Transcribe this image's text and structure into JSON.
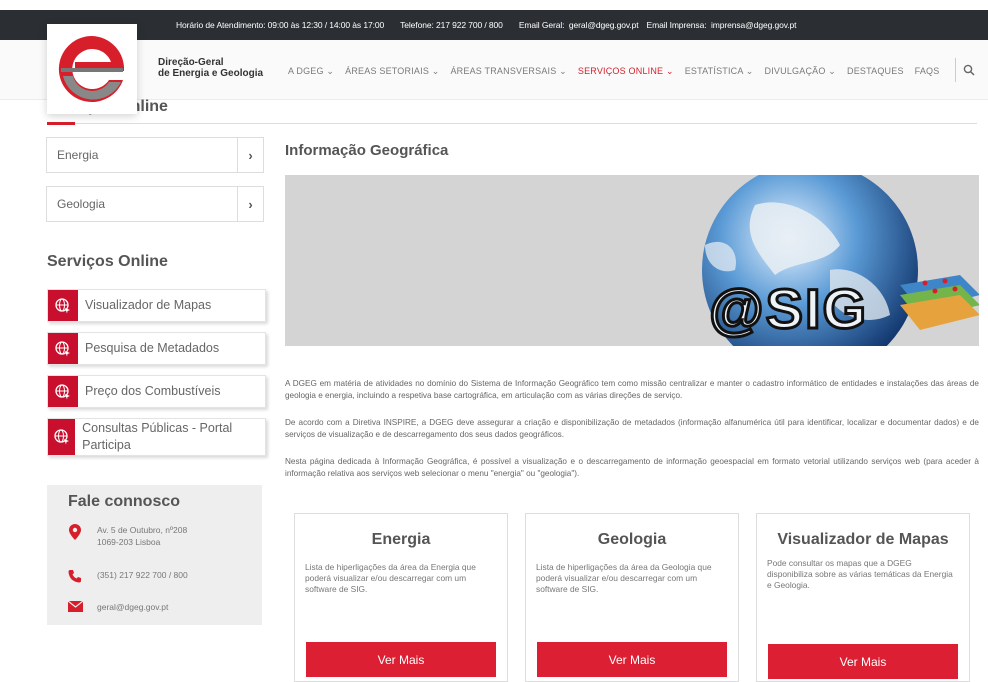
{
  "topbar": {
    "hours": "Horário de Atendimento: 09:00 às 12:30 / 14:00 às 17:00",
    "phone": "Telefone: 217 922 700 / 800",
    "email_geral_label": "Email Geral:",
    "email_geral": "geral@dgeg.gov.pt",
    "email_imprensa_label": "Email Imprensa:",
    "email_imprensa": "imprensa@dgeg.gov.pt"
  },
  "brand": {
    "line1": "Direção-Geral",
    "line2": "de Energia e Geologia",
    "accent": "#d71f2b"
  },
  "menu": [
    {
      "label": "A DGEG ⌄"
    },
    {
      "label": "ÁREAS SETORIAIS ⌄"
    },
    {
      "label": "ÁREAS TRANSVERSAIS ⌄"
    },
    {
      "label": "SERVIÇOS ONLINE ⌄"
    },
    {
      "label": "ESTATÍSTICA ⌄"
    },
    {
      "label": "DIVULGAÇÃO ⌄"
    },
    {
      "label": "DESTAQUES"
    },
    {
      "label": "FAQS"
    }
  ],
  "sidebar": {
    "top_title": "Serviços Online",
    "categories": [
      {
        "label": "Energia"
      },
      {
        "label": "Geologia"
      }
    ],
    "services_title": "Serviços Online",
    "services": [
      {
        "label": "Visualizador de Mapas"
      },
      {
        "label": "Pesquisa de Metadados"
      },
      {
        "label": "Preço dos Combustíveis"
      },
      {
        "label": "Consultas Públicas - Portal Participa"
      }
    ]
  },
  "contact": {
    "title": "Fale connosco",
    "address_line1": "Av. 5 de Outubro, nº208",
    "address_line2": "1069-203 Lisboa",
    "phone": "(351) 217 922 700 / 800",
    "email": "geral@dgeg.gov.pt"
  },
  "main": {
    "title": "Informação Geográfica",
    "banner_text": "@SIG",
    "paragraphs": [
      "A DGEG em matéria de atividades no domínio do Sistema de Informação Geográfico tem como missão centralizar e manter o cadastro informático de entidades e instalações das áreas de geologia e energia, incluindo a respetiva base cartográfica, em articulação com as várias direções de serviço.",
      "De acordo com a Diretiva INSPIRE, a DGEG deve assegurar a criação e disponibilização de metadados (informação alfanumérica útil para identificar, localizar e documentar dados) e de serviços de visualização e de descarregamento dos seus dados geográficos.",
      "Nesta página dedicada à Informação Geográfica, é possível a visualização e o descarregamento de informação geoespacial em formato vetorial utilizando serviços web (para aceder à informação relativa aos serviços web selecionar o menu \"energia\" ou \"geologia\")."
    ]
  },
  "cards": [
    {
      "title": "Energia",
      "text": "Lista de hiperligações da área da Energia que poderá visualizar e/ou descarregar com um software de SIG.",
      "button": "Ver Mais"
    },
    {
      "title": "Geologia",
      "text": "Lista de hiperligações da área da Geologia que poderá visualizar e/ou descarregar com um software de SIG.",
      "button": "Ver Mais"
    },
    {
      "title": "Visualizador de Mapas",
      "text": "Pode consultar os mapas que a DGEG disponibiliza sobre as várias temáticas da Energia e Geologia.",
      "button": "Ver Mais"
    }
  ]
}
